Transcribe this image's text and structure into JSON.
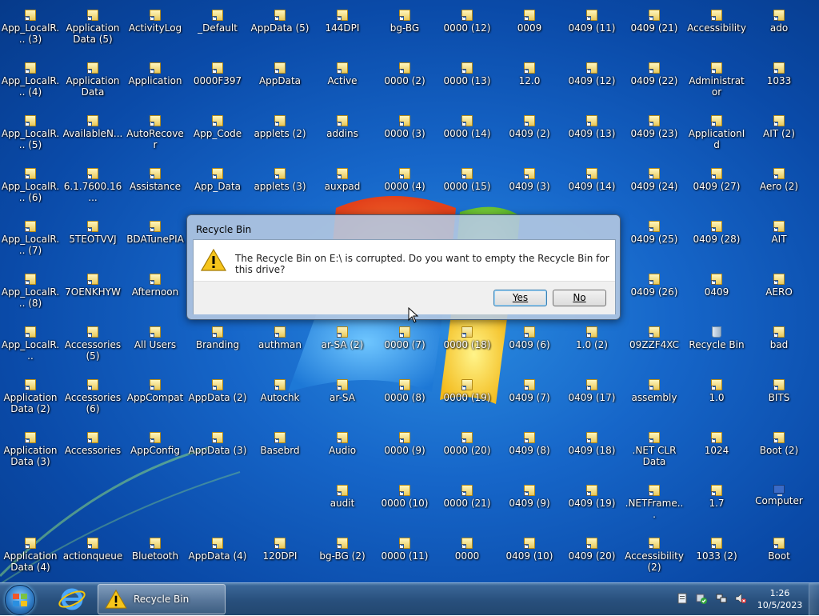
{
  "desktop": {
    "icons": [
      {
        "label": "App_LocalR... (3)",
        "type": "folder"
      },
      {
        "label": "Application Data (5)",
        "type": "folder"
      },
      {
        "label": "ActivityLog",
        "type": "folder"
      },
      {
        "label": "_Default",
        "type": "folder"
      },
      {
        "label": "AppData (5)",
        "type": "folder"
      },
      {
        "label": "144DPI",
        "type": "folder"
      },
      {
        "label": "bg-BG",
        "type": "folder"
      },
      {
        "label": "0000 (12)",
        "type": "folder"
      },
      {
        "label": "0009",
        "type": "folder"
      },
      {
        "label": "0409 (11)",
        "type": "folder"
      },
      {
        "label": "0409 (21)",
        "type": "folder"
      },
      {
        "label": "Accessibility",
        "type": "folder"
      },
      {
        "label": "ado",
        "type": "folder"
      },
      {
        "label": "App_LocalR... (4)",
        "type": "folder"
      },
      {
        "label": "Application Data",
        "type": "folder"
      },
      {
        "label": "Application",
        "type": "folder"
      },
      {
        "label": "0000F397",
        "type": "folder"
      },
      {
        "label": "AppData",
        "type": "folder"
      },
      {
        "label": "Active",
        "type": "folder"
      },
      {
        "label": "0000 (2)",
        "type": "folder"
      },
      {
        "label": "0000 (13)",
        "type": "folder"
      },
      {
        "label": "12.0",
        "type": "folder"
      },
      {
        "label": "0409 (12)",
        "type": "folder"
      },
      {
        "label": "0409 (22)",
        "type": "folder"
      },
      {
        "label": "Administrator",
        "type": "folder"
      },
      {
        "label": "1033",
        "type": "folder"
      },
      {
        "label": "App_LocalR... (5)",
        "type": "folder"
      },
      {
        "label": "AvailableN...",
        "type": "folder"
      },
      {
        "label": "AutoRecover",
        "type": "folder"
      },
      {
        "label": "App_Code",
        "type": "folder"
      },
      {
        "label": "applets (2)",
        "type": "folder"
      },
      {
        "label": "addins",
        "type": "folder"
      },
      {
        "label": "0000 (3)",
        "type": "folder"
      },
      {
        "label": "0000 (14)",
        "type": "folder"
      },
      {
        "label": "0409 (2)",
        "type": "folder"
      },
      {
        "label": "0409 (13)",
        "type": "folder"
      },
      {
        "label": "0409 (23)",
        "type": "folder"
      },
      {
        "label": "ApplicationId",
        "type": "folder"
      },
      {
        "label": "AIT (2)",
        "type": "folder"
      },
      {
        "label": "App_LocalR... (6)",
        "type": "folder"
      },
      {
        "label": "6.1.7600.16...",
        "type": "folder"
      },
      {
        "label": "Assistance",
        "type": "folder"
      },
      {
        "label": "App_Data",
        "type": "folder"
      },
      {
        "label": "applets (3)",
        "type": "folder"
      },
      {
        "label": "auxpad",
        "type": "folder"
      },
      {
        "label": "0000 (4)",
        "type": "folder"
      },
      {
        "label": "0000 (15)",
        "type": "folder"
      },
      {
        "label": "0409 (3)",
        "type": "folder"
      },
      {
        "label": "0409 (14)",
        "type": "folder"
      },
      {
        "label": "0409 (24)",
        "type": "folder"
      },
      {
        "label": "0409 (27)",
        "type": "folder"
      },
      {
        "label": "Aero (2)",
        "type": "folder"
      },
      {
        "label": "App_LocalR... (7)",
        "type": "folder"
      },
      {
        "label": "5TEOTVVJ",
        "type": "folder"
      },
      {
        "label": "BDATunePIA",
        "type": "folder"
      },
      {
        "label": "0409 (25)",
        "type": "folder"
      },
      {
        "label": "0409 (28)",
        "type": "folder"
      },
      {
        "label": "AIT",
        "type": "folder"
      },
      {
        "label": "App_LocalR... (8)",
        "type": "folder"
      },
      {
        "label": "7OENKHYW",
        "type": "folder"
      },
      {
        "label": "Afternoon",
        "type": "folder"
      },
      {
        "label": "0409 (26)",
        "type": "folder"
      },
      {
        "label": "0409",
        "type": "folder"
      },
      {
        "label": "AERO",
        "type": "folder"
      },
      {
        "label": "App_LocalR...",
        "type": "folder"
      },
      {
        "label": "Accessories (5)",
        "type": "folder"
      },
      {
        "label": "All Users",
        "type": "folder"
      },
      {
        "label": "Branding",
        "type": "folder"
      },
      {
        "label": "authman",
        "type": "folder"
      },
      {
        "label": "ar-SA (2)",
        "type": "folder"
      },
      {
        "label": "0000 (7)",
        "type": "folder"
      },
      {
        "label": "0000 (18)",
        "type": "folder"
      },
      {
        "label": "0409 (6)",
        "type": "folder"
      },
      {
        "label": "1.0 (2)",
        "type": "folder"
      },
      {
        "label": "09ZZF4XC",
        "type": "folder"
      },
      {
        "label": "Recycle Bin",
        "type": "bin"
      },
      {
        "label": "bad",
        "type": "folder"
      },
      {
        "label": "Application Data (2)",
        "type": "folder"
      },
      {
        "label": "Accessories (6)",
        "type": "folder"
      },
      {
        "label": "AppCompat",
        "type": "folder"
      },
      {
        "label": "AppData (2)",
        "type": "folder"
      },
      {
        "label": "Autochk",
        "type": "folder"
      },
      {
        "label": "ar-SA",
        "type": "folder"
      },
      {
        "label": "0000 (8)",
        "type": "folder"
      },
      {
        "label": "0000 (19)",
        "type": "folder"
      },
      {
        "label": "0409 (7)",
        "type": "folder"
      },
      {
        "label": "0409 (17)",
        "type": "folder"
      },
      {
        "label": "assembly",
        "type": "folder"
      },
      {
        "label": "1.0",
        "type": "folder"
      },
      {
        "label": "BITS",
        "type": "folder"
      },
      {
        "label": "Application Data (3)",
        "type": "folder"
      },
      {
        "label": "Accessories",
        "type": "folder"
      },
      {
        "label": "AppConfig",
        "type": "folder"
      },
      {
        "label": "AppData (3)",
        "type": "folder"
      },
      {
        "label": "Basebrd",
        "type": "folder"
      },
      {
        "label": "Audio",
        "type": "folder"
      },
      {
        "label": "0000 (9)",
        "type": "folder"
      },
      {
        "label": "0000 (20)",
        "type": "folder"
      },
      {
        "label": "0409 (8)",
        "type": "folder"
      },
      {
        "label": "0409 (18)",
        "type": "folder"
      },
      {
        "label": ".NET CLR Data",
        "type": "folder"
      },
      {
        "label": "1024",
        "type": "folder"
      },
      {
        "label": "Boot (2)",
        "type": "folder"
      },
      {
        "label": "audit",
        "type": "folder"
      },
      {
        "label": "0000 (10)",
        "type": "folder"
      },
      {
        "label": "0000 (21)",
        "type": "folder"
      },
      {
        "label": "0409 (9)",
        "type": "folder"
      },
      {
        "label": "0409 (19)",
        "type": "folder"
      },
      {
        "label": ".NETFrame...",
        "type": "folder"
      },
      {
        "label": "1.7",
        "type": "folder"
      },
      {
        "label": "Computer",
        "type": "computer"
      },
      {
        "label": "Application Data (4)",
        "type": "folder"
      },
      {
        "label": "actionqueue",
        "type": "folder"
      },
      {
        "label": "Bluetooth",
        "type": "folder"
      },
      {
        "label": "AppData (4)",
        "type": "folder"
      },
      {
        "label": "120DPI",
        "type": "folder"
      },
      {
        "label": "bg-BG (2)",
        "type": "folder"
      },
      {
        "label": "0000 (11)",
        "type": "folder"
      },
      {
        "label": "0000",
        "type": "folder"
      },
      {
        "label": "0409 (10)",
        "type": "folder"
      },
      {
        "label": "0409 (20)",
        "type": "folder"
      },
      {
        "label": "Accessibility (2)",
        "type": "folder"
      },
      {
        "label": "1033 (2)",
        "type": "folder"
      },
      {
        "label": "Boot",
        "type": "folder"
      }
    ]
  },
  "dialog": {
    "title": "Recycle Bin",
    "message": "The Recycle Bin on E:\\ is corrupted. Do you want to empty the Recycle Bin for this drive?",
    "icon": "warning-icon",
    "yes_label": "Yes",
    "no_label": "No"
  },
  "taskbar": {
    "pinned": [
      "internet-explorer-icon"
    ],
    "tasks": [
      {
        "label": "Recycle Bin",
        "icon": "warning-icon"
      }
    ],
    "tray_icons": [
      "action-center-icon",
      "network-icon",
      "volume-muted-icon"
    ],
    "clock_time": "1:26",
    "clock_date": "10/5/2023"
  }
}
